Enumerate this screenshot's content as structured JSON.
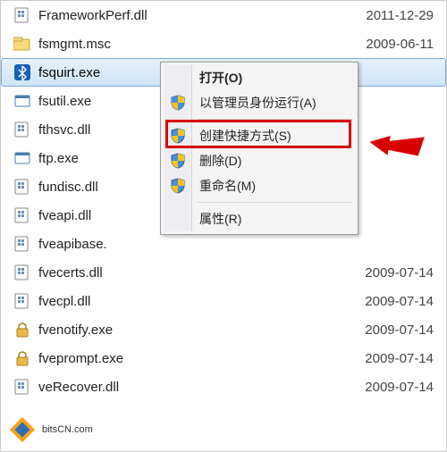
{
  "files": [
    {
      "name": "FrameworkPerf.dll",
      "date": "2011-12-29",
      "icon": "dll"
    },
    {
      "name": "fsmgmt.msc",
      "date": "2009-06-11",
      "icon": "msc"
    },
    {
      "name": "fsquirt.exe",
      "date": "",
      "icon": "bluetooth",
      "selected": true
    },
    {
      "name": "fsutil.exe",
      "date": "",
      "icon": "exe"
    },
    {
      "name": "fthsvc.dll",
      "date": "",
      "icon": "dll"
    },
    {
      "name": "ftp.exe",
      "date": "",
      "icon": "exe"
    },
    {
      "name": "fundisc.dll",
      "date": "",
      "icon": "dll"
    },
    {
      "name": "fveapi.dll",
      "date": "",
      "icon": "dll"
    },
    {
      "name": "fveapibase.",
      "date": "",
      "icon": "dll"
    },
    {
      "name": "fvecerts.dll",
      "date": "2009-07-14",
      "icon": "dll"
    },
    {
      "name": "fvecpl.dll",
      "date": "2009-07-14",
      "icon": "dll"
    },
    {
      "name": "fvenotify.exe",
      "date": "2009-07-14",
      "icon": "lock-exe"
    },
    {
      "name": "fveprompt.exe",
      "date": "2009-07-14",
      "icon": "lock-exe"
    },
    {
      "name": "veRecover.dll",
      "date": "2009-07-14",
      "icon": "dll"
    }
  ],
  "menu": {
    "open": "打开(O)",
    "run_admin": "以管理员身份运行(A)",
    "shortcut": "创建快捷方式(S)",
    "delete": "删除(D)",
    "rename": "重命名(M)",
    "properties": "属性(R)"
  },
  "watermark": "bitsCN.com"
}
